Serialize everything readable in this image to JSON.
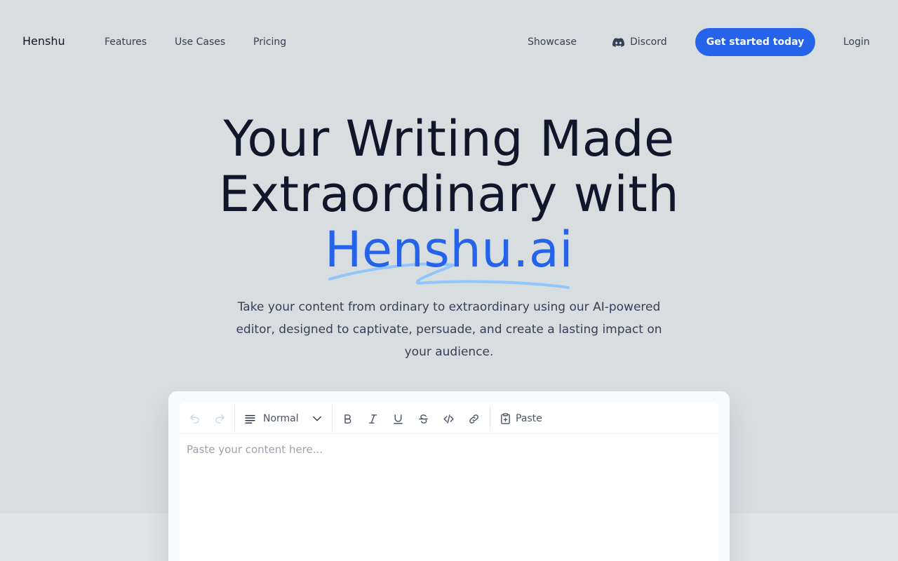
{
  "nav": {
    "brand": "Henshu",
    "links": [
      {
        "label": "Features"
      },
      {
        "label": "Use Cases"
      },
      {
        "label": "Pricing"
      }
    ],
    "showcase": "Showcase",
    "discord": "Discord",
    "cta": "Get started today",
    "login": "Login"
  },
  "hero": {
    "title_line1": "Your Writing Made",
    "title_line2": "Extraordinary with",
    "title_accent": "Henshu.ai",
    "subtitle": "Take your content from ordinary to extraordinary using our AI-powered editor, designed to captivate, persuade, and create a lasting impact on your audience."
  },
  "editor": {
    "block_type": "Normal",
    "paste_label": "Paste",
    "placeholder": "Paste your content here...",
    "toolbar_icons": [
      "undo-icon",
      "redo-icon",
      "paragraph-icon",
      "chevron-down-icon",
      "bold-icon",
      "italic-icon",
      "underline-icon",
      "strikethrough-icon",
      "code-icon",
      "link-icon",
      "clipboard-icon"
    ]
  },
  "colors": {
    "accent": "#2563eb",
    "background": "#d8dee0",
    "heading": "#0f172a"
  }
}
